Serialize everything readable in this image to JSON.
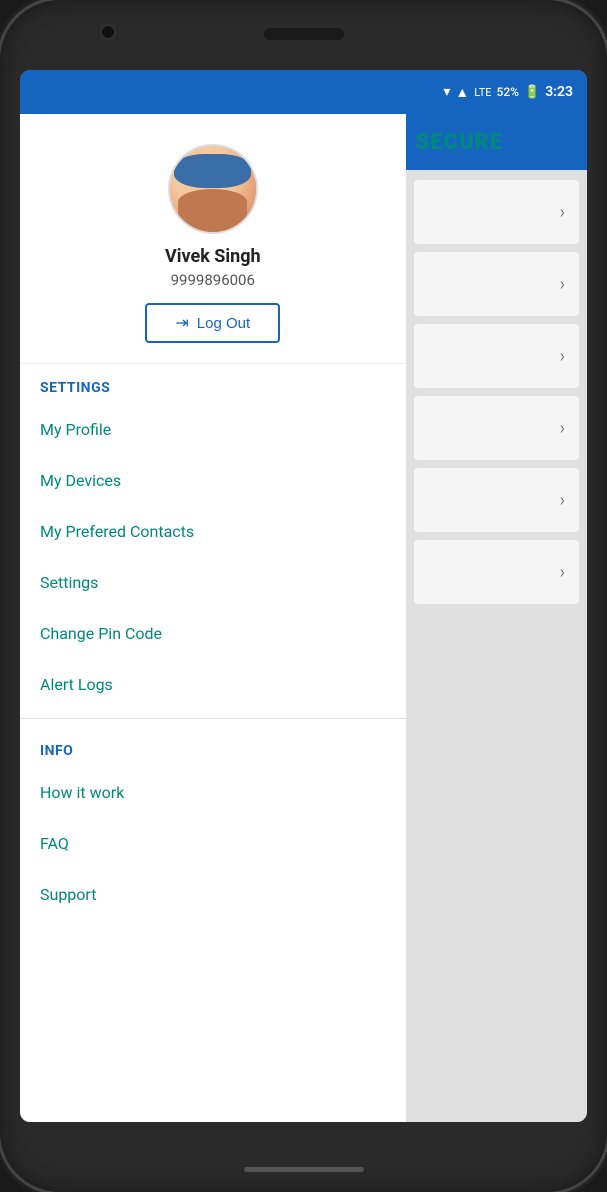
{
  "status_bar": {
    "battery": "52%",
    "time": "3:23"
  },
  "profile": {
    "name": "Vivek Singh",
    "phone": "9999896006",
    "logout_label": "Log Out"
  },
  "settings_section": {
    "header": "SETTINGS",
    "items": [
      {
        "label": "My Profile"
      },
      {
        "label": "My Devices"
      },
      {
        "label": "My Prefered Contacts"
      },
      {
        "label": "Settings"
      },
      {
        "label": "Change Pin Code"
      },
      {
        "label": "Alert Logs"
      }
    ]
  },
  "info_section": {
    "header": "INFO",
    "items": [
      {
        "label": "How it work"
      },
      {
        "label": "FAQ"
      },
      {
        "label": "Support"
      }
    ]
  },
  "right_panel": {
    "app_name": "SECURE",
    "cards": 6
  }
}
